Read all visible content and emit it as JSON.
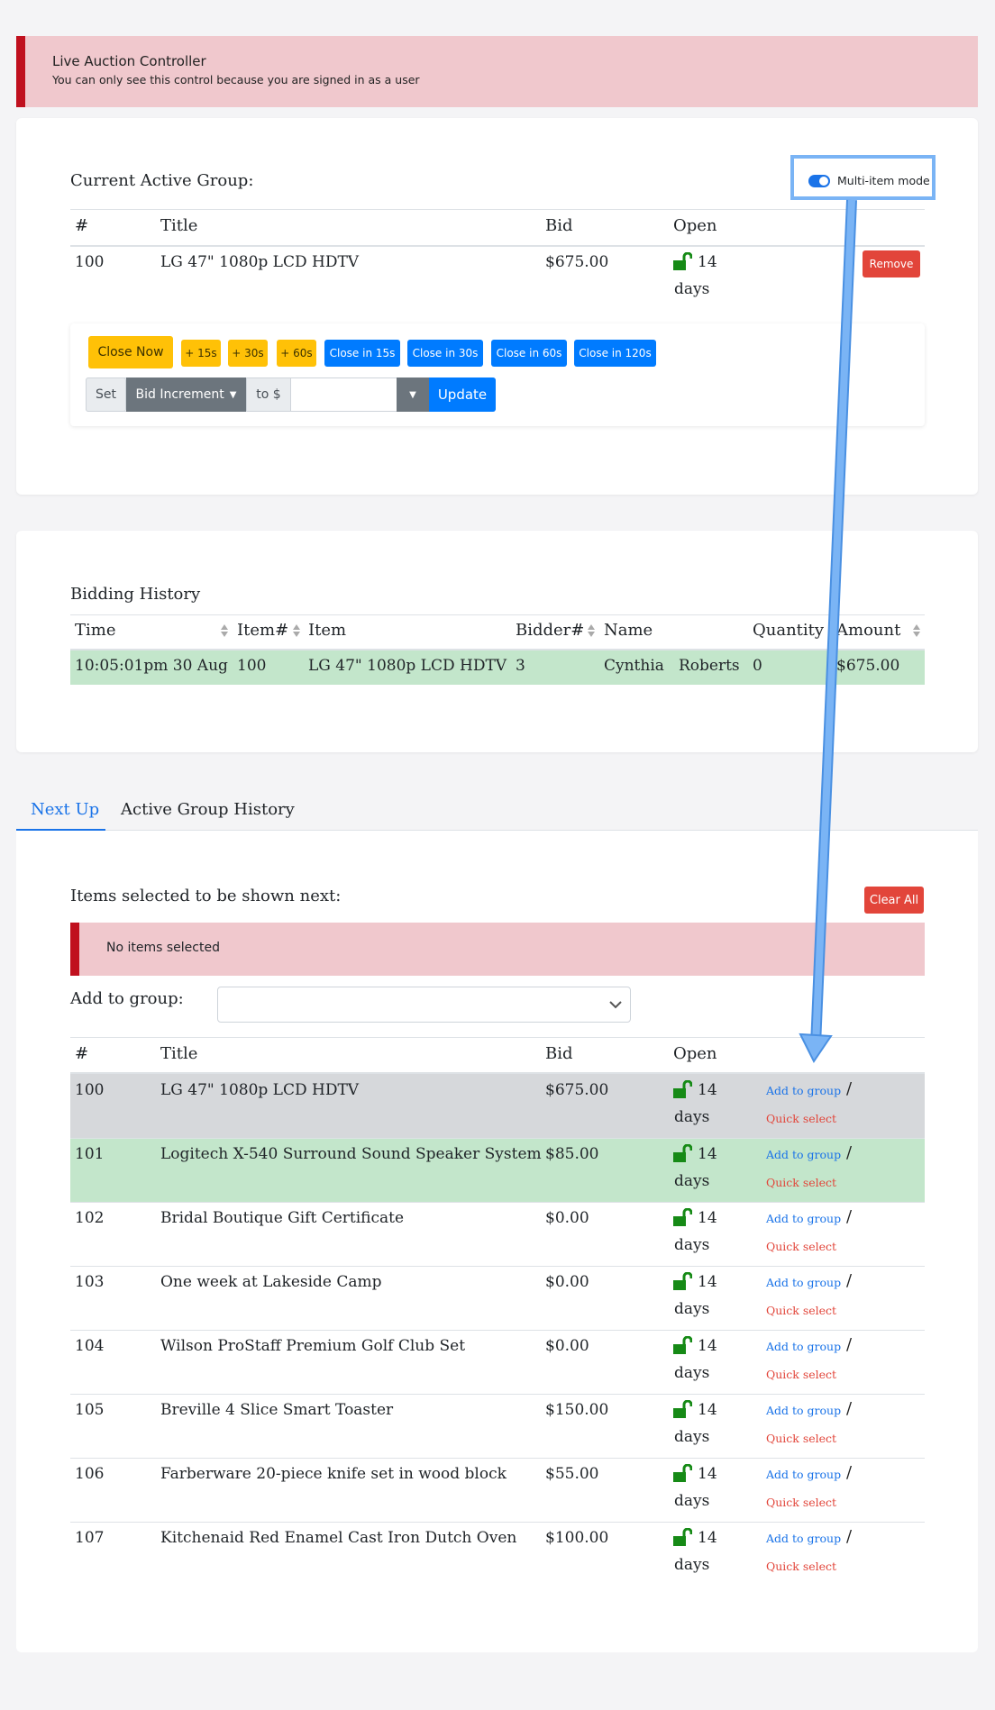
{
  "alert": {
    "title": "Live Auction Controller",
    "subtitle": "You can only see this control because you are signed in as a user"
  },
  "active_group": {
    "heading": "Current Active Group:",
    "toggle_label": "Multi-item mode",
    "columns": [
      "#",
      "Title",
      "Bid",
      "Open"
    ],
    "row": {
      "num": "100",
      "title": "LG 47\" 1080p LCD HDTV",
      "bid": "$675.00",
      "open_num": "14",
      "open_unit": "days"
    },
    "remove_label": "Remove"
  },
  "controls": {
    "close_now": "Close Now",
    "plus15": "+ 15s",
    "plus30": "+ 30s",
    "plus60": "+ 60s",
    "close15": "Close in 15s",
    "close30": "Close in 30s",
    "close60": "Close in 60s",
    "close120": "Close in 120s",
    "set": "Set",
    "bid_increment": "Bid Increment",
    "to": "to $",
    "amount_value": "",
    "update": "Update"
  },
  "history": {
    "heading": "Bidding History",
    "columns": [
      "Time",
      "Item#",
      "Item",
      "Bidder#",
      "Name",
      "Quantity",
      "Amount"
    ],
    "row": {
      "time": "10:05:01pm 30 Aug",
      "item_num": "100",
      "item": "LG 47\" 1080p LCD HDTV",
      "bidder": "3",
      "first": "Cynthia",
      "last": "Roberts",
      "qty": "0",
      "amount": "$675.00"
    }
  },
  "tabs": {
    "next_up": "Next Up",
    "history": "Active Group History"
  },
  "next_up": {
    "heading": "Items selected to be shown next:",
    "clear_all": "Clear All",
    "empty_alert": "No items selected",
    "add_to_group_label": "Add to group:",
    "select_value": "",
    "columns": [
      "#",
      "Title",
      "Bid",
      "Open"
    ],
    "add_link": "Add to group",
    "quick_link": "Quick select",
    "slash": "/",
    "items": [
      {
        "num": "100",
        "title": "LG 47\" 1080p LCD HDTV",
        "bid": "$675.00",
        "open_num": "14",
        "open_unit": "days"
      },
      {
        "num": "101",
        "title": "Logitech X-540 Surround Sound Speaker System",
        "bid": "$85.00",
        "open_num": "14",
        "open_unit": "days"
      },
      {
        "num": "102",
        "title": "Bridal Boutique Gift Certificate",
        "bid": "$0.00",
        "open_num": "14",
        "open_unit": "days"
      },
      {
        "num": "103",
        "title": "One week at Lakeside Camp",
        "bid": "$0.00",
        "open_num": "14",
        "open_unit": "days"
      },
      {
        "num": "104",
        "title": "Wilson ProStaff Premium Golf Club Set",
        "bid": "$0.00",
        "open_num": "14",
        "open_unit": "days"
      },
      {
        "num": "105",
        "title": "Breville 4 Slice Smart Toaster",
        "bid": "$150.00",
        "open_num": "14",
        "open_unit": "days"
      },
      {
        "num": "106",
        "title": "Farberware 20-piece knife set in wood block",
        "bid": "$55.00",
        "open_num": "14",
        "open_unit": "days"
      },
      {
        "num": "107",
        "title": "Kitchenaid Red Enamel Cast Iron Dutch Oven",
        "bid": "$100.00",
        "open_num": "14",
        "open_unit": "days"
      }
    ]
  },
  "colors": {
    "alert_bg": "#f0c8cd",
    "alert_border": "#c0101e",
    "primary": "#007bff",
    "warning": "#ffc107",
    "danger": "#e2453a",
    "success_row": "#c3e6cb",
    "selected_row": "#d6d8db",
    "lock": "#168a16",
    "callout": "#7ab4f5"
  }
}
